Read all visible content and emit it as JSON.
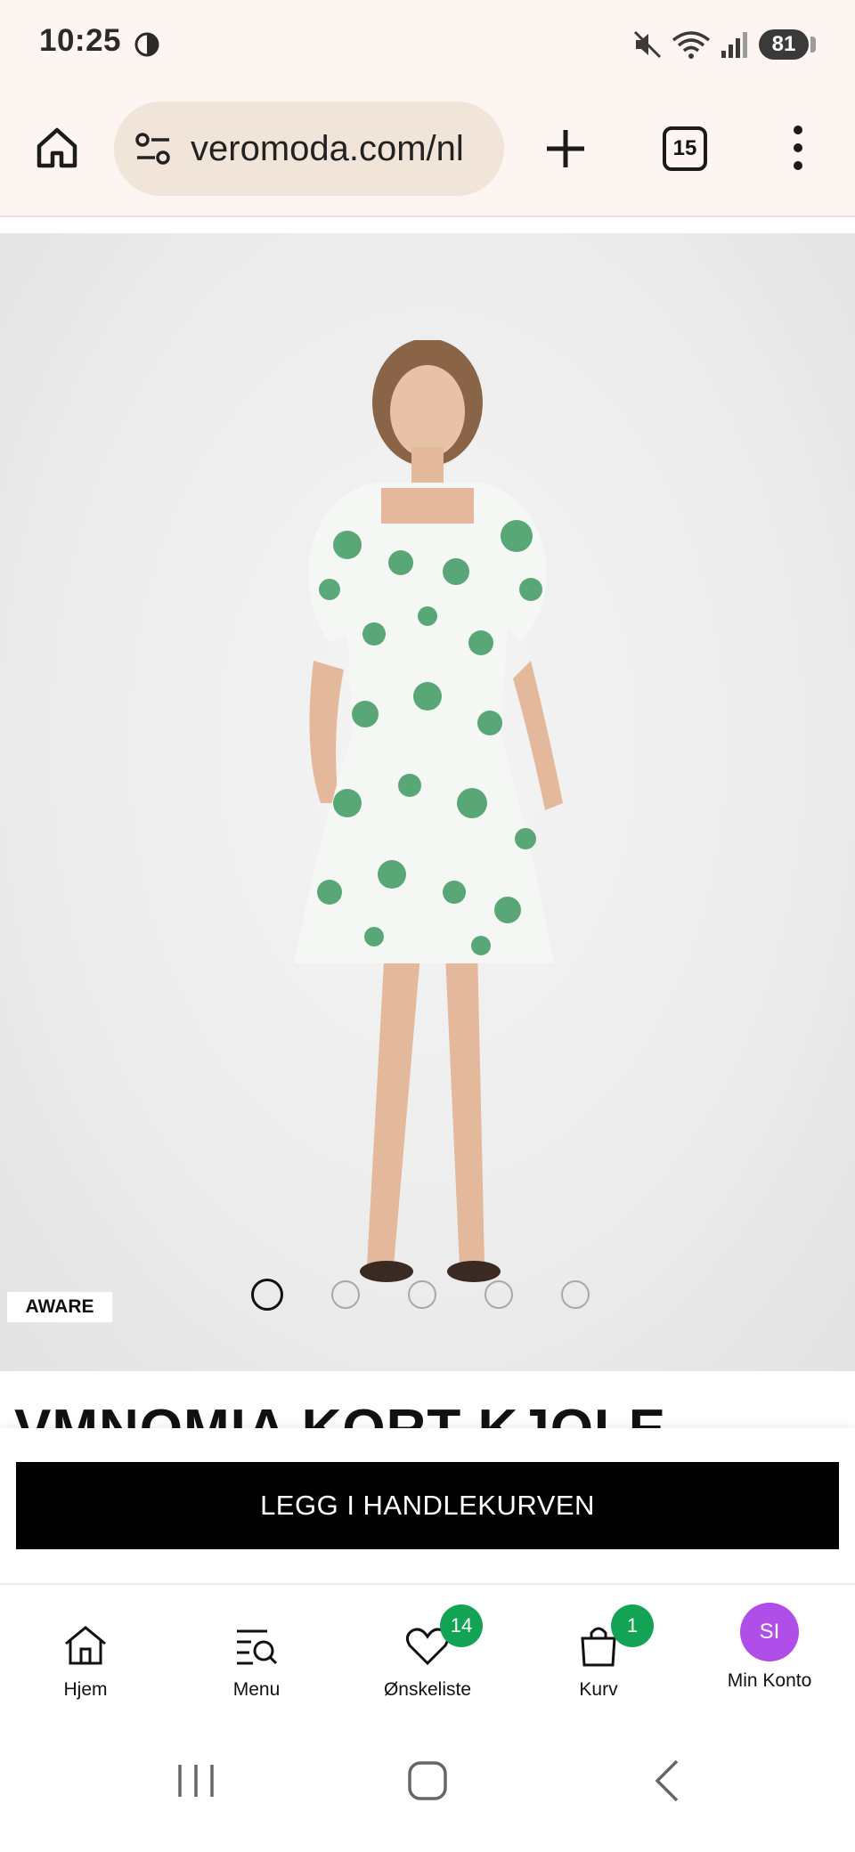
{
  "status_bar": {
    "time": "10:25",
    "battery": "81"
  },
  "browser": {
    "url": "veromoda.com/nl",
    "tab_count": "15"
  },
  "product": {
    "badge": "AWARE",
    "title": "VMNOMIA KORT KJOLE",
    "add_to_cart_label": "LEGG I HANDLEKURVEN",
    "image_count": 5,
    "active_image_index": 0
  },
  "bottom_nav": {
    "items": [
      {
        "label": "Hjem",
        "icon": "home-icon"
      },
      {
        "label": "Menu",
        "icon": "menu-search-icon"
      },
      {
        "label": "Ønskeliste",
        "icon": "heart-icon",
        "badge": "14"
      },
      {
        "label": "Kurv",
        "icon": "bag-icon",
        "badge": "1"
      },
      {
        "label": "Min Konto",
        "icon": "avatar",
        "initials": "SI"
      }
    ]
  },
  "colors": {
    "accent_green": "#12a355",
    "avatar_purple": "#b04ee9",
    "cta_black": "#000000",
    "browser_bg": "#fdf5f1"
  }
}
